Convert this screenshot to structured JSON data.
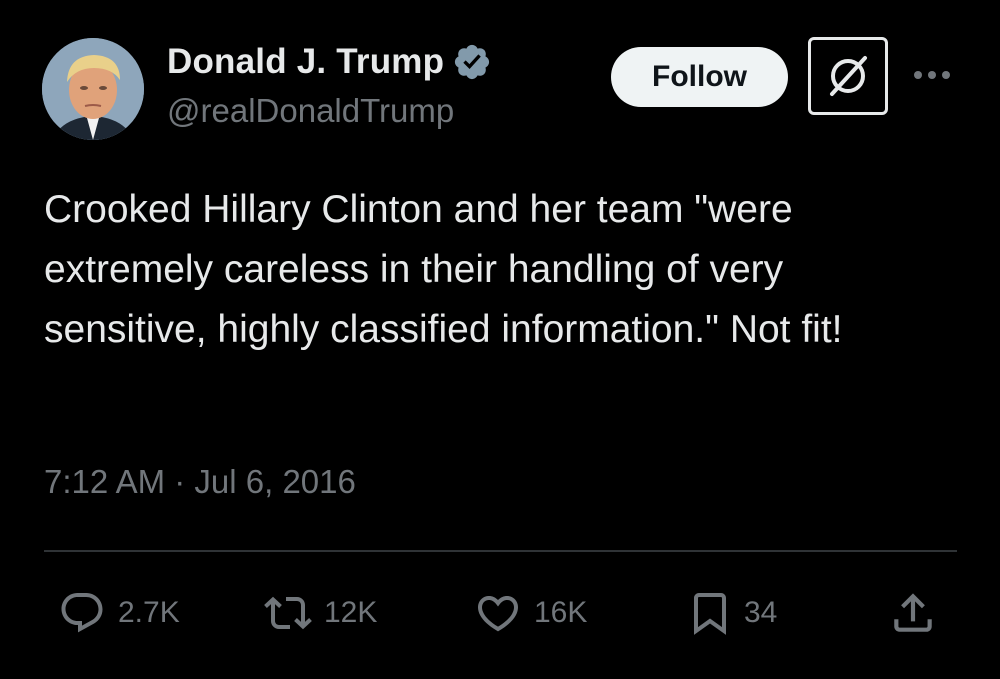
{
  "author": {
    "display_name": "Donald J. Trump",
    "handle": "@realDonaldTrump",
    "verified": true,
    "verified_color": "#829aab"
  },
  "header": {
    "follow_label": "Follow",
    "grok_icon": "grok-icon",
    "more_icon": "more-dots-icon"
  },
  "tweet": {
    "text": "Crooked Hillary Clinton and her team \"were extremely careless in their handling of very sensitive, highly classified information.\" Not fit!",
    "timestamp": "7:12 AM · Jul 6, 2016"
  },
  "actions": {
    "replies": "2.7K",
    "retweets": "12K",
    "likes": "16K",
    "bookmarks": "34",
    "share_icon": "share-icon"
  },
  "colors": {
    "background": "#000000",
    "text_primary": "#e7e9ea",
    "text_secondary": "#71767b",
    "divider": "#2f3336",
    "button_bg": "#eff3f4"
  }
}
